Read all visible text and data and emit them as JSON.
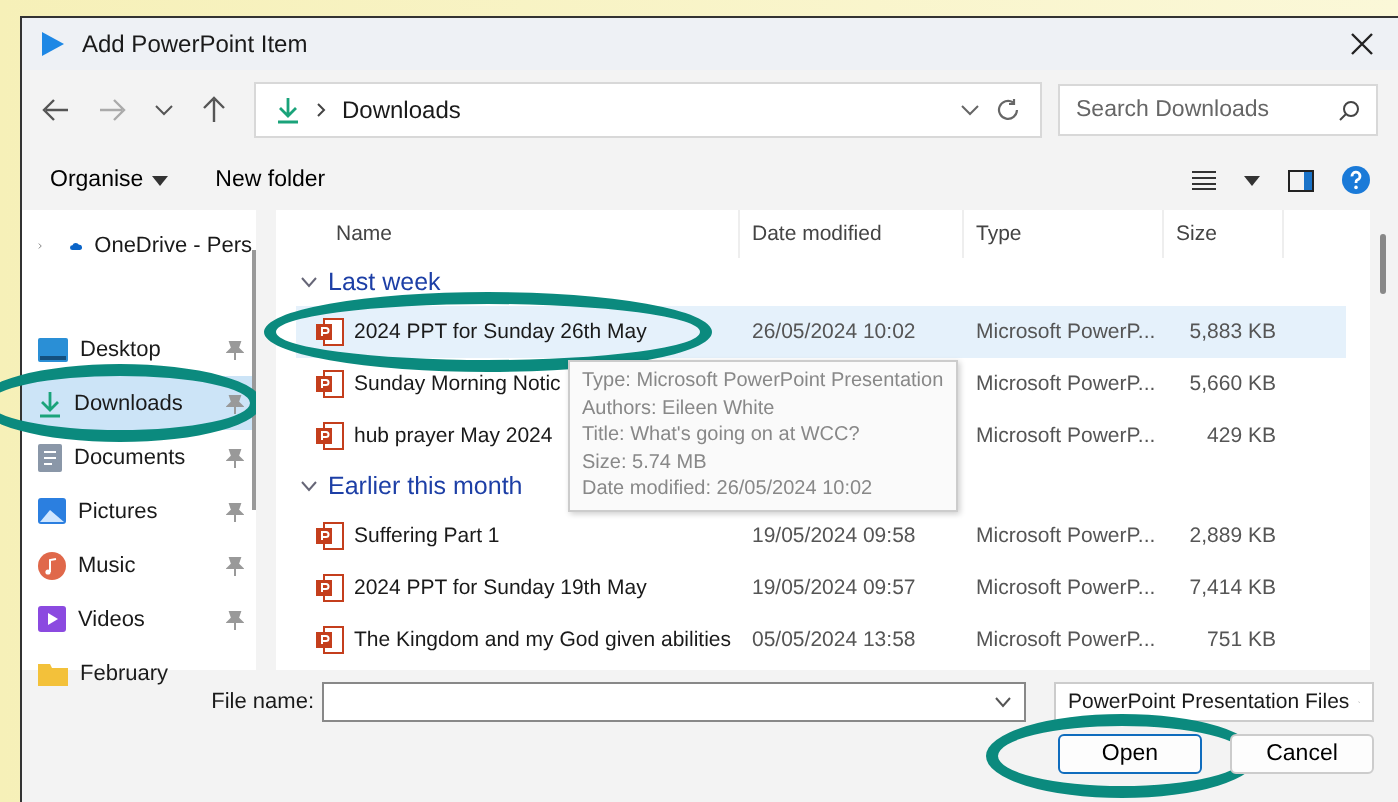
{
  "window": {
    "title": "Add PowerPoint Item"
  },
  "nav": {
    "path": "Downloads",
    "search_placeholder": "Search Downloads"
  },
  "toolbar": {
    "organise": "Organise",
    "new_folder": "New folder"
  },
  "sidebar": {
    "items": [
      {
        "label": "OneDrive - Pers",
        "kind": "cloud",
        "selected": false,
        "pinned": false,
        "highlighted": false
      },
      {
        "label": "Desktop",
        "kind": "desktop",
        "selected": false,
        "pinned": true,
        "highlighted": false
      },
      {
        "label": "Downloads",
        "kind": "download",
        "selected": true,
        "pinned": true,
        "highlighted": true
      },
      {
        "label": "Documents",
        "kind": "documents",
        "selected": false,
        "pinned": true,
        "highlighted": false
      },
      {
        "label": "Pictures",
        "kind": "pictures",
        "selected": false,
        "pinned": true,
        "highlighted": false
      },
      {
        "label": "Music",
        "kind": "music",
        "selected": false,
        "pinned": true,
        "highlighted": false
      },
      {
        "label": "Videos",
        "kind": "videos",
        "selected": false,
        "pinned": true,
        "highlighted": false
      },
      {
        "label": "February",
        "kind": "folder",
        "selected": false,
        "pinned": false,
        "highlighted": false
      }
    ]
  },
  "columns": [
    "Name",
    "Date modified",
    "Type",
    "Size"
  ],
  "groups": [
    {
      "label": "Last week",
      "rows": [
        {
          "name": "2024 PPT for Sunday 26th May",
          "date": "26/05/2024 10:02",
          "type": "Microsoft PowerP...",
          "size": "5,883 KB",
          "selected": true,
          "highlighted": true
        },
        {
          "name": "Sunday Morning Notic",
          "type": "Microsoft PowerP...",
          "size": "5,660 KB",
          "selected": false,
          "highlighted": false
        },
        {
          "name": "hub prayer May 2024",
          "type": "Microsoft PowerP...",
          "size": "429 KB",
          "selected": false,
          "highlighted": false
        }
      ]
    },
    {
      "label": "Earlier this month",
      "rows": [
        {
          "name": "Suffering Part 1",
          "date": "19/05/2024 09:58",
          "type": "Microsoft PowerP...",
          "size": "2,889 KB",
          "selected": false,
          "highlighted": false
        },
        {
          "name": "2024 PPT for Sunday 19th May",
          "date": "19/05/2024 09:57",
          "type": "Microsoft PowerP...",
          "size": "7,414 KB",
          "selected": false,
          "highlighted": false
        },
        {
          "name": "The Kingdom and my God given abilities",
          "date": "05/05/2024 13:58",
          "type": "Microsoft PowerP...",
          "size": "751 KB",
          "selected": false,
          "highlighted": false
        }
      ]
    }
  ],
  "tooltip": {
    "lines": [
      "Type: Microsoft PowerPoint Presentation",
      "Authors: Eileen White",
      "Title: What's going on at WCC?",
      "Size: 5.74 MB",
      "Date modified: 26/05/2024 10:02"
    ]
  },
  "footer": {
    "file_name_label": "File name:",
    "filter": "PowerPoint Presentation Files",
    "buttons": [
      {
        "label": "Open",
        "kind": "primary",
        "highlighted": true
      },
      {
        "label": "Cancel",
        "kind": "secondary",
        "highlighted": false
      }
    ]
  }
}
